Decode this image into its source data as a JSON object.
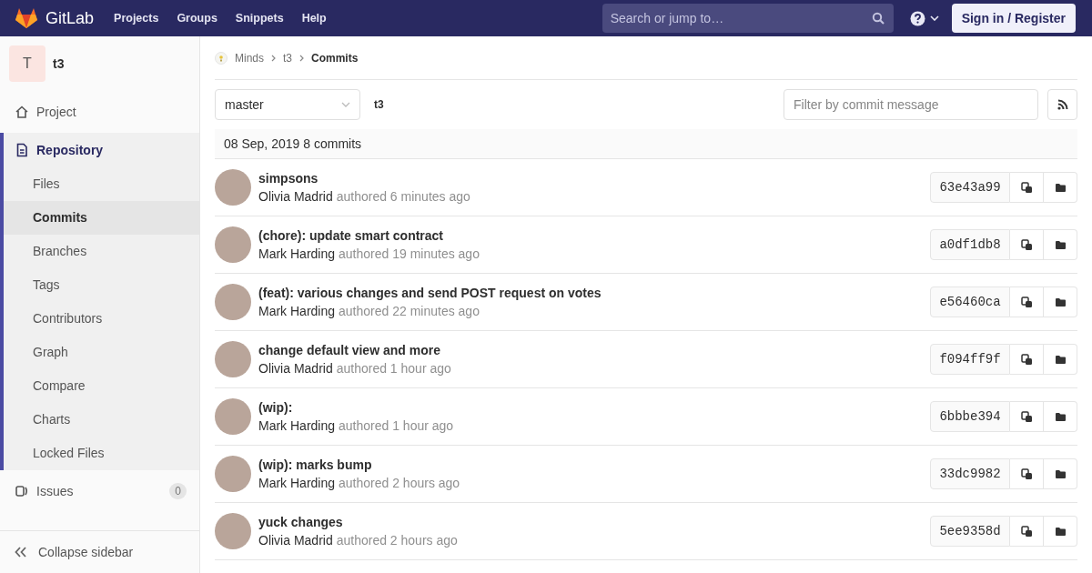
{
  "navbar": {
    "brand": "GitLab",
    "links": [
      "Projects",
      "Groups",
      "Snippets",
      "Help"
    ],
    "search": {
      "placeholder": "Search or jump to…"
    },
    "sign_in": "Sign in / Register"
  },
  "sidebar": {
    "project": {
      "initial": "T",
      "name": "t3"
    },
    "items": [
      {
        "label": "Project",
        "selected": false
      },
      {
        "label": "Repository",
        "selected": true,
        "children": [
          {
            "label": "Files",
            "selected": false
          },
          {
            "label": "Commits",
            "selected": true
          },
          {
            "label": "Branches",
            "selected": false
          },
          {
            "label": "Tags",
            "selected": false
          },
          {
            "label": "Contributors",
            "selected": false
          },
          {
            "label": "Graph",
            "selected": false
          },
          {
            "label": "Compare",
            "selected": false
          },
          {
            "label": "Charts",
            "selected": false
          },
          {
            "label": "Locked Files",
            "selected": false
          }
        ]
      },
      {
        "label": "Issues",
        "selected": false,
        "count": "0"
      }
    ],
    "collapse": "Collapse sidebar"
  },
  "breadcrumb": [
    "Minds",
    "t3",
    "Commits"
  ],
  "toolbar": {
    "branch": "master",
    "path": "t3",
    "filter": {
      "placeholder": "Filter by commit message"
    }
  },
  "day": {
    "date": "08 Sep, 2019",
    "count": "8 commits"
  },
  "commits": [
    {
      "title": "simpsons",
      "author": "Olivia Madrid",
      "action": "authored",
      "time": "6 minutes ago",
      "sha": "63e43a99"
    },
    {
      "title": "(chore): update smart contract",
      "author": "Mark Harding",
      "action": "authored",
      "time": "19 minutes ago",
      "sha": "a0df1db8"
    },
    {
      "title": "(feat): various changes and send POST request on votes",
      "author": "Mark Harding",
      "action": "authored",
      "time": "22 minutes ago",
      "sha": "e56460ca"
    },
    {
      "title": "change default view and more",
      "author": "Olivia Madrid",
      "action": "authored",
      "time": "1 hour ago",
      "sha": "f094ff9f"
    },
    {
      "title": "(wip):",
      "author": "Mark Harding",
      "action": "authored",
      "time": "1 hour ago",
      "sha": "6bbbe394"
    },
    {
      "title": "(wip): marks bump",
      "author": "Mark Harding",
      "action": "authored",
      "time": "2 hours ago",
      "sha": "33dc9982"
    },
    {
      "title": "yuck changes",
      "author": "Olivia Madrid",
      "action": "authored",
      "time": "2 hours ago",
      "sha": "5ee9358d"
    }
  ]
}
